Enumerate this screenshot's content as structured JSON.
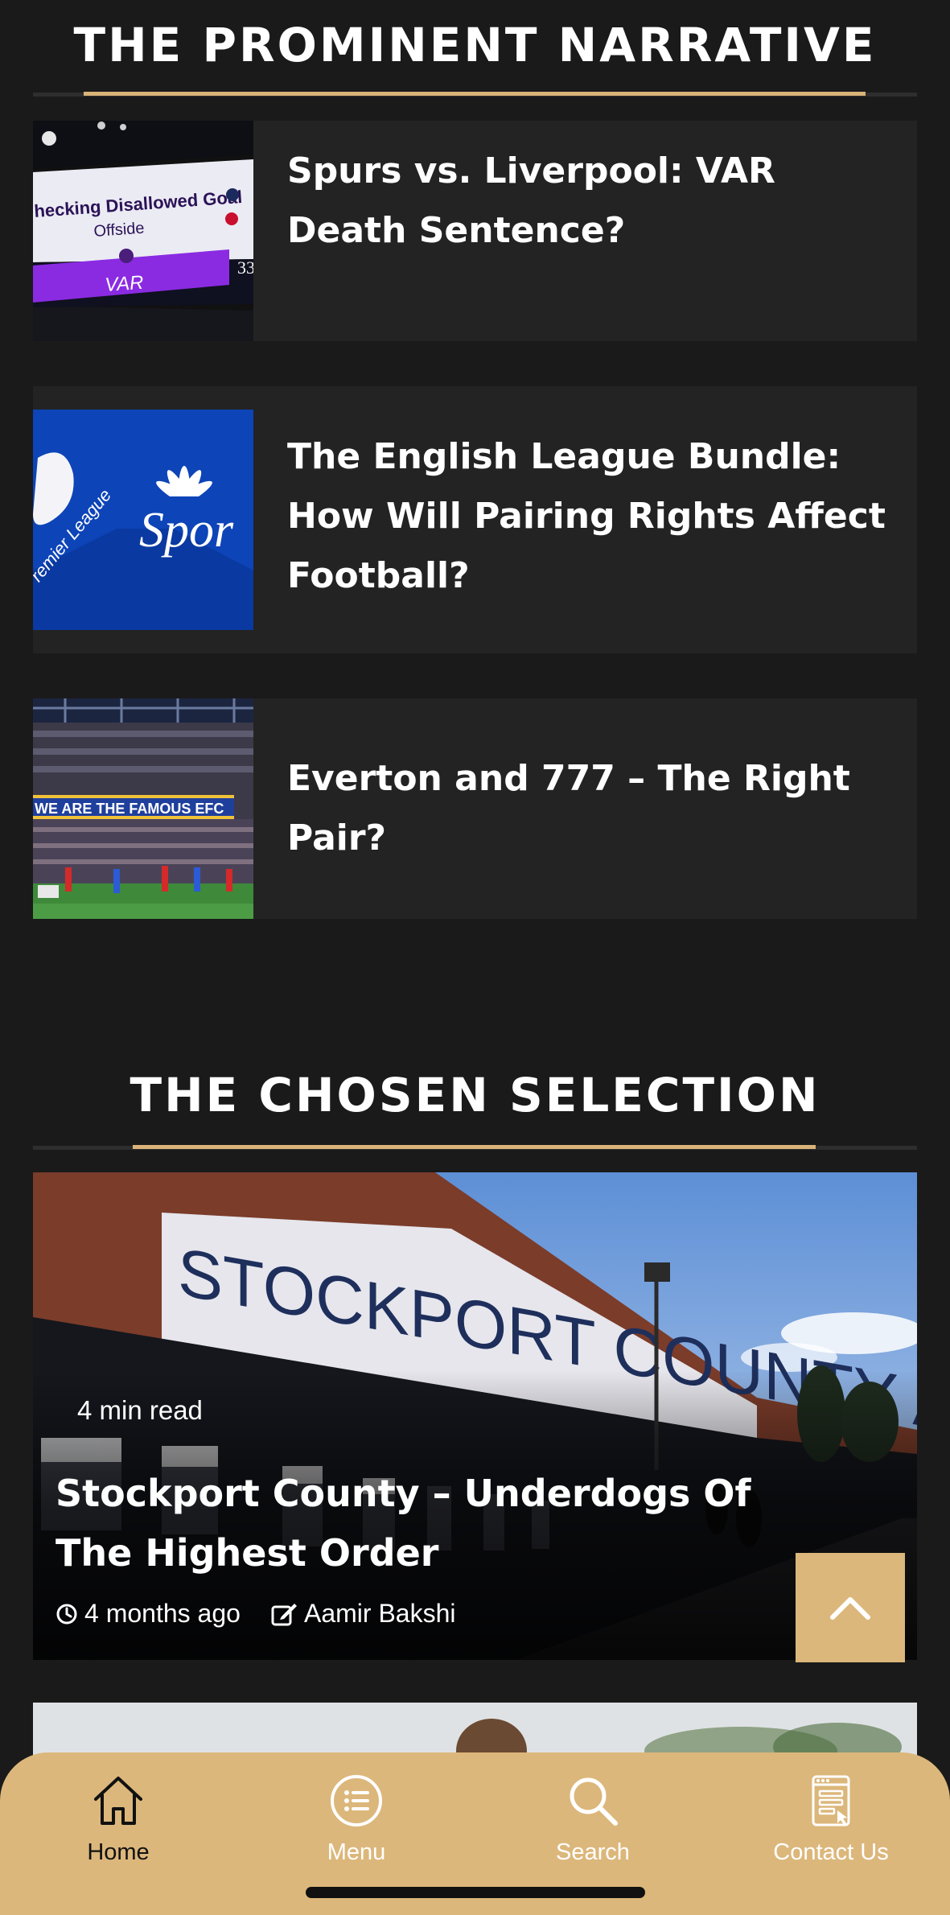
{
  "sections": {
    "narrative_title": "THE PROMINENT NARRATIVE",
    "selection_title": "THE CHOSEN SELECTION"
  },
  "narrative_cards": [
    {
      "title": "Spurs vs. Liverpool: VAR Death Sentence?",
      "thumb_text_top": "hecking Disallowed Goal",
      "thumb_text_mid": "Offside",
      "thumb_text_bottom": "VAR",
      "thumb_number": "33"
    },
    {
      "title": "The English League Bundle: How Will Pairing Rights Affect Football?",
      "thumb_text_left": "remier League",
      "thumb_text_right": "Spor"
    },
    {
      "title": "Everton and 777 – The Right Pair?",
      "thumb_banner": "WE ARE THE FAMOUS EFC"
    }
  ],
  "featured": {
    "read_time": "4 min read",
    "title": "Stockport County – Underdogs Of The Highest Order",
    "time_ago": "4 months ago",
    "author": "Aamir Bakshi",
    "sign_text": "STOCKPORT COUNTY A.F.C"
  },
  "bottom_nav": [
    {
      "label": "Home",
      "icon": "home-icon",
      "active": true
    },
    {
      "label": "Menu",
      "icon": "menu-list-icon",
      "active": false
    },
    {
      "label": "Search",
      "icon": "search-icon",
      "active": false
    },
    {
      "label": "Contact Us",
      "icon": "contact-form-icon",
      "active": false
    }
  ],
  "colors": {
    "background": "#1a1a1a",
    "card": "#232323",
    "accent_gold": "#dcb77b",
    "nav_active": "#111111",
    "nav_inactive": "#ffffff"
  }
}
